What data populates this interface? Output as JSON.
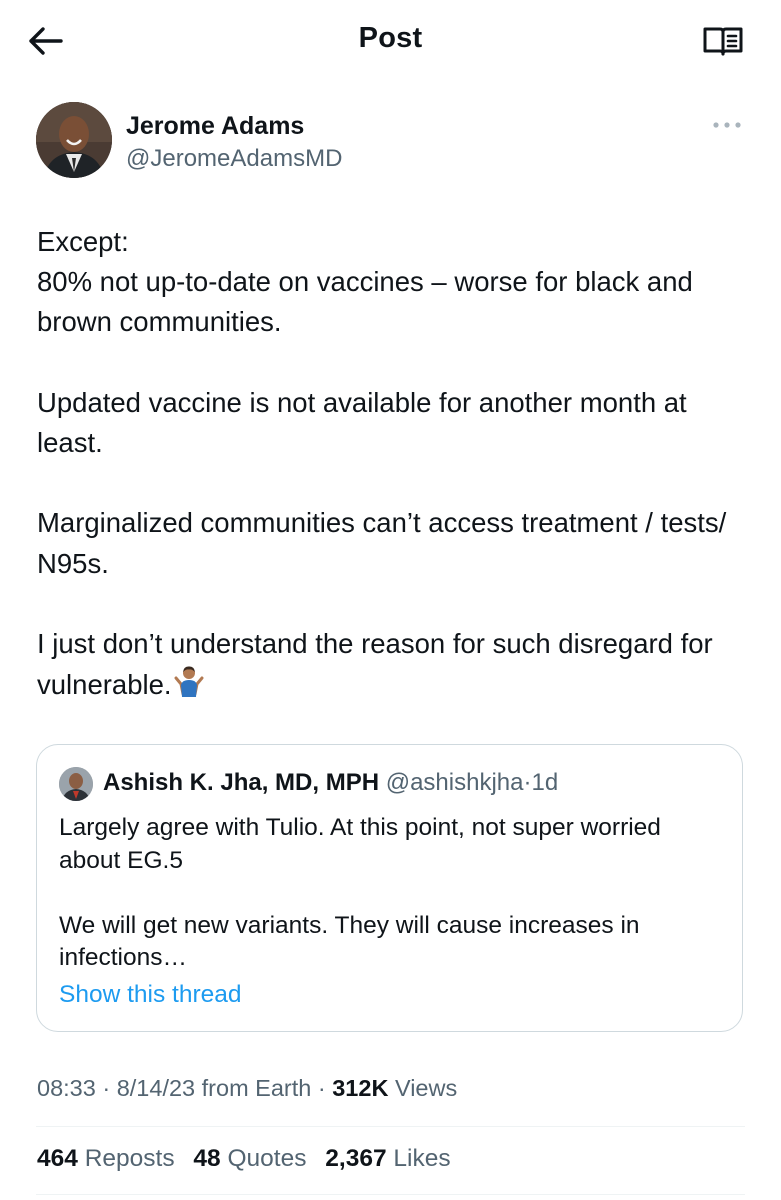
{
  "header": {
    "title": "Post",
    "back_icon": "arrow-left-icon",
    "reader_icon": "book-open-icon"
  },
  "author": {
    "name": "Jerome Adams",
    "handle": "@JeromeAdamsMD",
    "more_icon": "more-horizontal-icon"
  },
  "post": {
    "paragraphs": [
      {
        "lines": [
          "Except:",
          "80% not up-to-date on vaccines – worse for black and brown communities."
        ]
      },
      {
        "text": "Updated vaccine is not available for another month at least."
      },
      {
        "text": "Marginalized communities can’t access treatment / tests/ N95s."
      },
      {
        "text": "I just don’t understand the reason for such disregard for vulnerable."
      }
    ],
    "emoji": "person-shrugging-emoji"
  },
  "quote": {
    "name": "Ashish K. Jha, MD, MPH",
    "handle": "@ashishkjha",
    "separator": "·",
    "time": "1d",
    "paragraphs": [
      "Largely agree with Tulio. At this point, not super worried about EG.5",
      "We will get new variants. They will cause increases in infections…"
    ],
    "show_thread": "Show this thread"
  },
  "meta": {
    "time": "08:33",
    "sep1": "·",
    "date_source": "8/14/23 from Earth",
    "sep2": "·",
    "views_count": "312K",
    "views_label": "Views"
  },
  "stats": {
    "reposts_count": "464",
    "reposts_label": "Reposts",
    "quotes_count": "48",
    "quotes_label": "Quotes",
    "likes_count": "2,367",
    "likes_label": "Likes"
  },
  "colors": {
    "text": "#0f1419",
    "secondary": "#536471",
    "link": "#1d9bf0",
    "border": "#cfd9de"
  }
}
